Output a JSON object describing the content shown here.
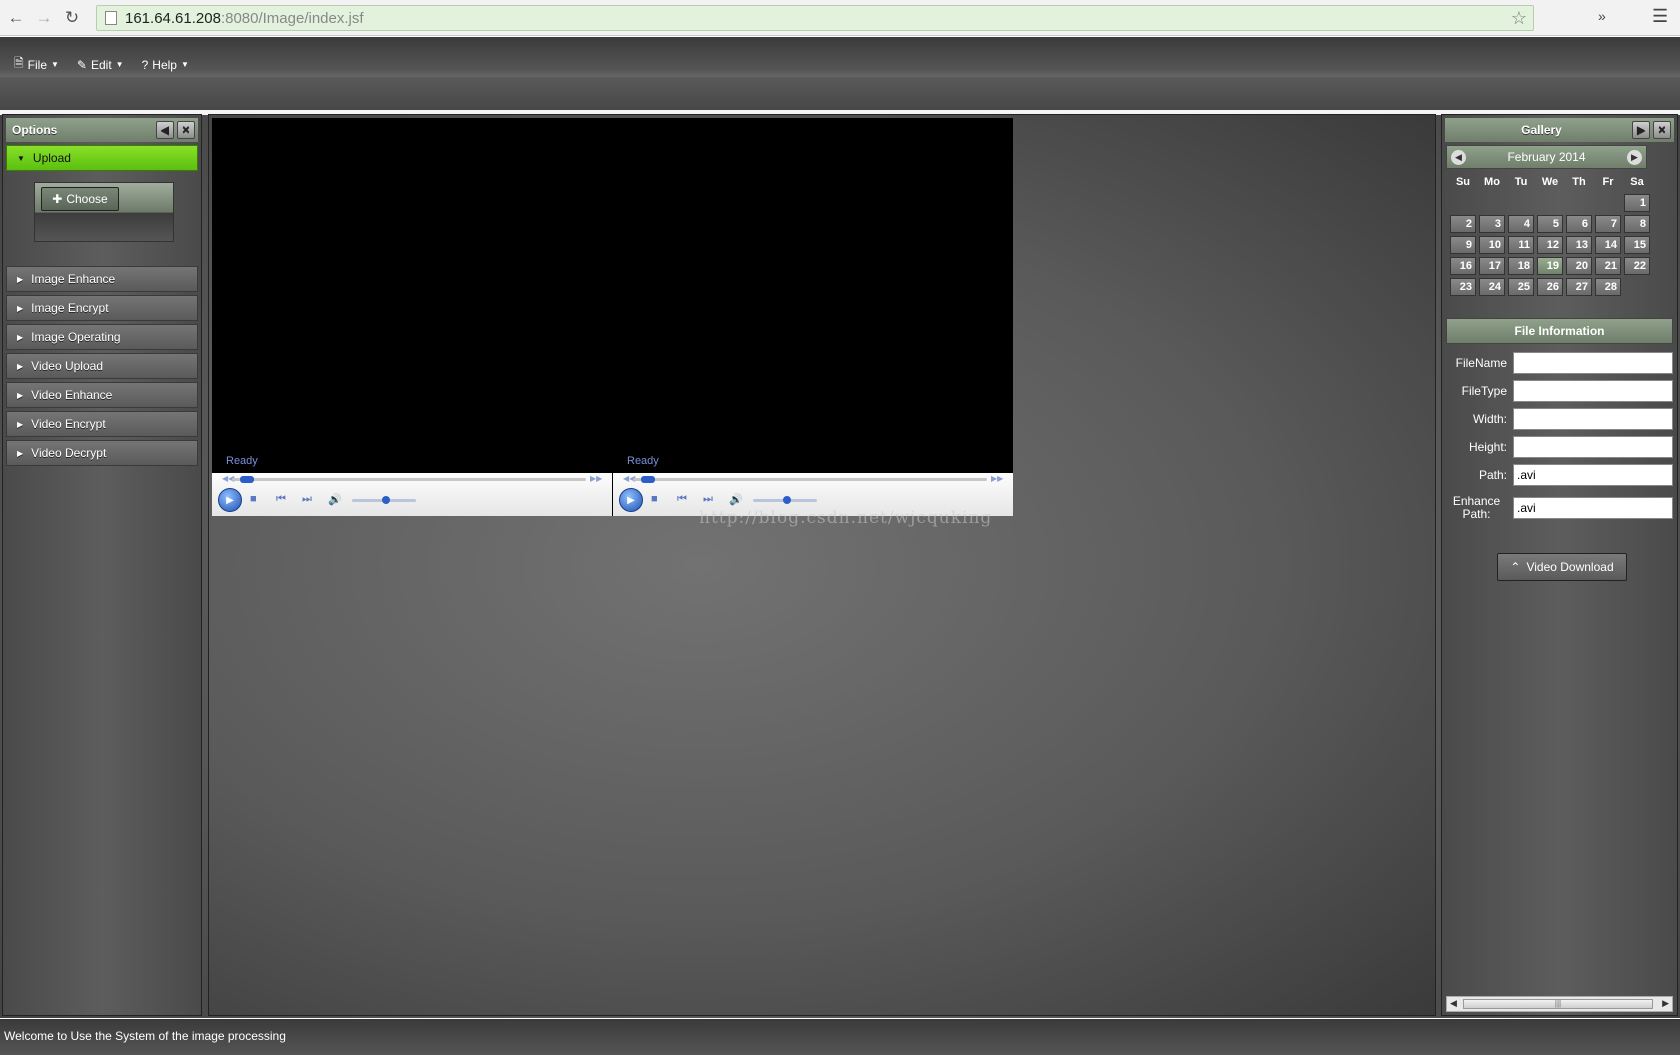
{
  "browser": {
    "url_host": "161.64.61.208",
    "url_rest": ":8080/Image/index.jsf"
  },
  "menubar": {
    "items": [
      {
        "label": "File",
        "icon": "document-icon"
      },
      {
        "label": "Edit",
        "icon": "pencil-icon"
      },
      {
        "label": "Help",
        "icon": "question-icon"
      }
    ]
  },
  "options": {
    "title": "Options",
    "active": "Upload",
    "choose_label": "Choose",
    "sections": [
      "Image Enhance",
      "Image Encrypt",
      "Image Operating",
      "Video Upload",
      "Video Enhance",
      "Video Encrypt",
      "Video Decrypt"
    ]
  },
  "players": [
    {
      "status": "Ready"
    },
    {
      "status": "Ready"
    }
  ],
  "watermark": "http://blog.csdn.net/wjcquking",
  "gallery": {
    "title": "Gallery",
    "month": "February 2014",
    "dow": [
      "Su",
      "Mo",
      "Tu",
      "We",
      "Th",
      "Fr",
      "Sa"
    ],
    "today": 19
  },
  "file_info": {
    "title": "File Information",
    "filename_label": "FileName",
    "filetype_label": "FileType",
    "width_label": "Width:",
    "height_label": "Height:",
    "path_label": "Path:",
    "path_value": ".avi",
    "enhance_label": "Enhance Path:",
    "enhance_value": ".avi",
    "download_label": "Video Download"
  },
  "footer": "Welcome to Use the System of the image processing"
}
